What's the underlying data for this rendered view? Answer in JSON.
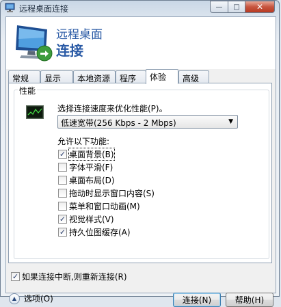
{
  "window": {
    "title": "远程桌面连接",
    "min_glyph": "—",
    "max_glyph": "□",
    "close_glyph": "✕"
  },
  "banner": {
    "line1": "远程桌面",
    "line2": "连接"
  },
  "tabs": [
    {
      "label": "常规",
      "active": false
    },
    {
      "label": "显示",
      "active": false
    },
    {
      "label": "本地资源",
      "active": false
    },
    {
      "label": "程序",
      "active": false
    },
    {
      "label": "体验",
      "active": true
    },
    {
      "label": "高级",
      "active": false
    }
  ],
  "performance": {
    "group_label": "性能",
    "speed_label": "选择连接速度来优化性能(P)。",
    "speed_value": "低速宽带(256 Kbps - 2 Mbps)",
    "combo_arrow": "▼",
    "allow_label": "允许以下功能:",
    "features": [
      {
        "label": "桌面背景(B)",
        "checked": true
      },
      {
        "label": "字体平滑(F)",
        "checked": false
      },
      {
        "label": "桌面布局(D)",
        "checked": false
      },
      {
        "label": "拖动时显示窗口内容(S)",
        "checked": false
      },
      {
        "label": "菜单和窗口动画(M)",
        "checked": false
      },
      {
        "label": "视觉样式(V)",
        "checked": true
      },
      {
        "label": "持久位图缓存(A)",
        "checked": true
      }
    ]
  },
  "reconnect": {
    "label": "如果连接中断,则重新连接(R)",
    "checked": true
  },
  "footer": {
    "options_label": "选项(O)",
    "options_glyph": "▲",
    "connect_label": "连接(N)",
    "help_label": "帮助(H)"
  },
  "check_glyph": "✓",
  "colors": {
    "accent": "#2a5aa5",
    "window_frame": "#6d7e92",
    "close_button": "#c7553f"
  }
}
